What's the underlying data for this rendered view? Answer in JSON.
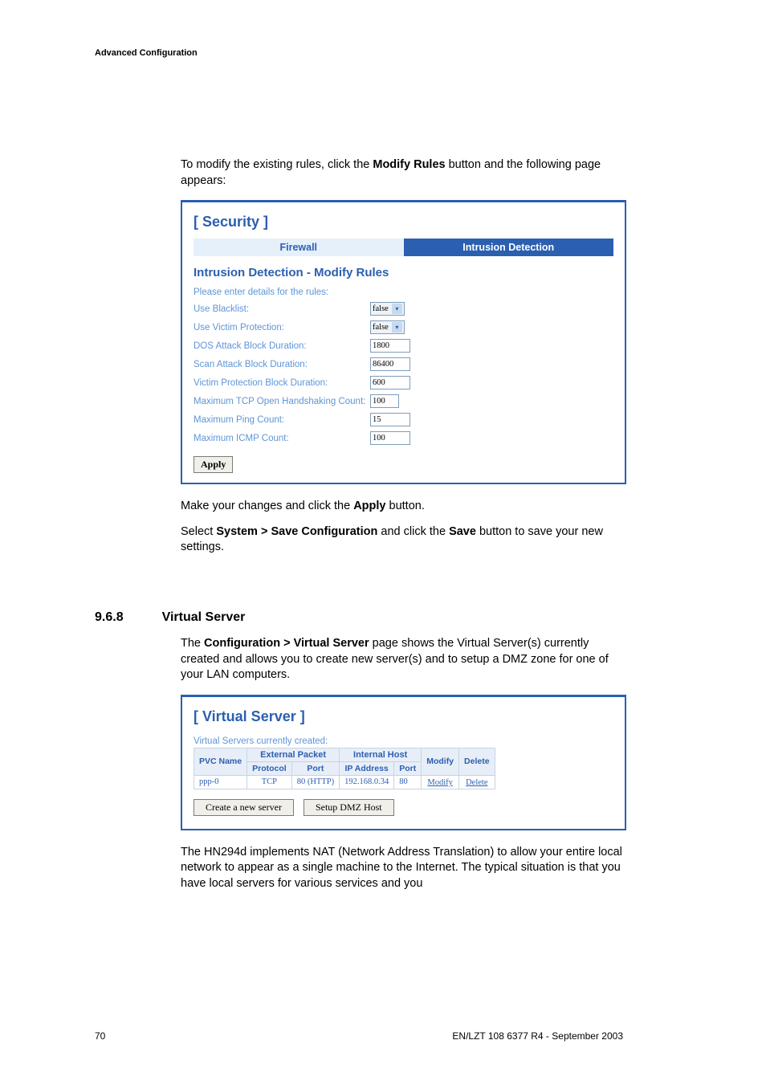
{
  "header": {
    "running_title": "Advanced Configuration"
  },
  "intro": {
    "line1a": "To modify the existing rules, click the ",
    "line1b": "Modify Rules",
    "line1c": " button and the following page appears:"
  },
  "security_shot": {
    "title": "[ Security ]",
    "tabs": {
      "firewall": "Firewall",
      "ids": "Intrusion Detection"
    },
    "subheading": "Intrusion Detection - Modify Rules",
    "prompt": "Please enter details for the rules:",
    "fields": [
      {
        "label": "Use Blacklist:",
        "type": "select",
        "value": "false"
      },
      {
        "label": "Use Victim Protection:",
        "type": "select",
        "value": "false"
      },
      {
        "label": "DOS Attack Block Duration:",
        "type": "input",
        "value": "1800"
      },
      {
        "label": "Scan Attack Block Duration:",
        "type": "input",
        "value": "86400"
      },
      {
        "label": "Victim Protection Block Duration:",
        "type": "input",
        "value": "600"
      },
      {
        "label": "Maximum TCP Open Handshaking Count:",
        "type": "input",
        "value": "100"
      },
      {
        "label": "Maximum Ping Count:",
        "type": "input",
        "value": "15"
      },
      {
        "label": "Maximum ICMP Count:",
        "type": "input",
        "value": "100"
      }
    ],
    "apply": "Apply"
  },
  "post_sec1": {
    "a": "Make your changes and click the ",
    "b": "Apply",
    "c": " button."
  },
  "post_sec2": {
    "a": "Select ",
    "b": "System > Save Configuration",
    "c": " and click the ",
    "d": "Save",
    "e": " button to save your new settings."
  },
  "section": {
    "num": "9.6.8",
    "title": "Virtual Server"
  },
  "vs_intro": {
    "a": "The ",
    "b": "Configuration > Virtual Server",
    "c": " page shows the Virtual Server(s) currently created and allows you to create new server(s) and to setup a DMZ zone for one of your LAN computers."
  },
  "vs_shot": {
    "title": "[ Virtual Server ]",
    "caption": "Virtual Servers currently created:",
    "groups": {
      "ext": "External Packet",
      "int": "Internal Host"
    },
    "cols": {
      "pvc": "PVC Name",
      "proto": "Protocol",
      "port": "Port",
      "ip": "IP Address",
      "port2": "Port",
      "mod": "Modify",
      "del": "Delete"
    },
    "row": {
      "pvc": "ppp-0",
      "proto": "TCP",
      "port": "80 (HTTP)",
      "ip": "192.168.0.34",
      "port2": "80",
      "mod": "Modify",
      "del": "Delete"
    },
    "buttons": {
      "create": "Create a new server",
      "dmz": "Setup DMZ Host"
    }
  },
  "vs_outro": "The HN294d implements NAT (Network Address Translation) to allow your entire local network to appear as a single machine to the Internet. The typical situation is that you have local servers for various services and you",
  "footer": {
    "page": "70",
    "docid": "EN/LZT 108 6377 R4 - September 2003"
  }
}
